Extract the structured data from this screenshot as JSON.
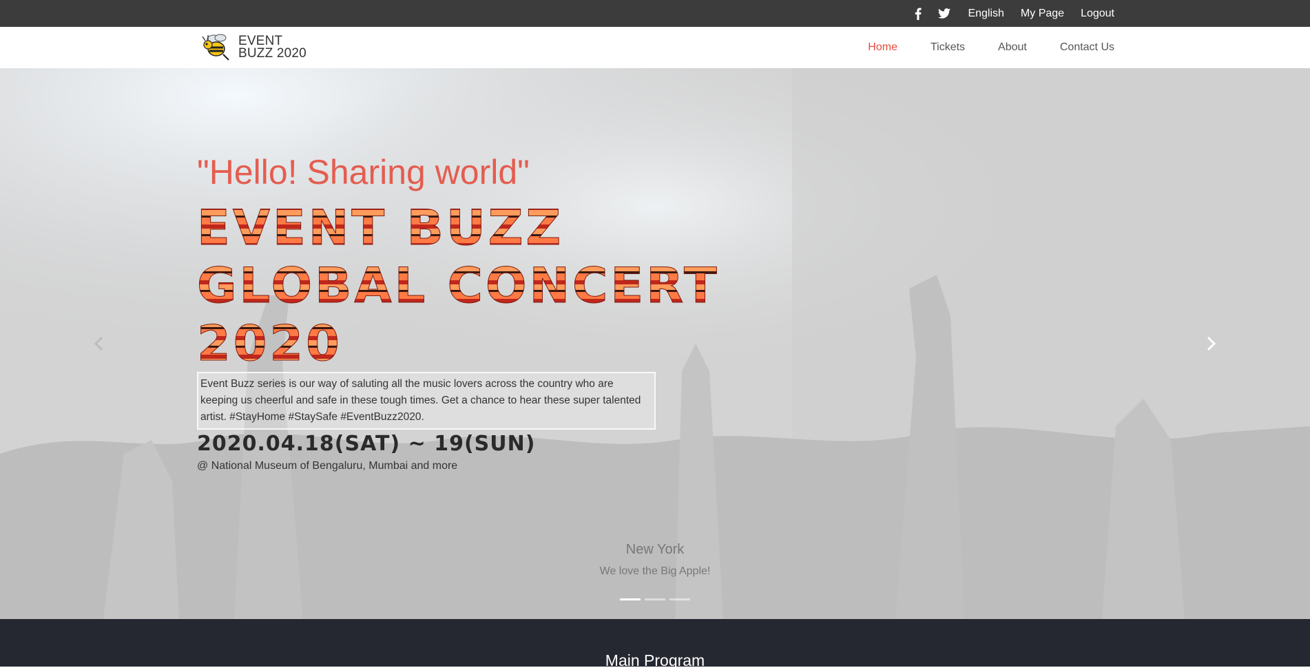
{
  "topbar": {
    "icons": [
      "facebook-icon",
      "twitter-icon"
    ],
    "language": "English",
    "my_page": "My Page",
    "logout": "Logout"
  },
  "logo": {
    "line1": "EVENT",
    "line2": "BUZZ 2020",
    "icon": "bee-icon"
  },
  "nav": {
    "items": [
      {
        "label": "Home",
        "active": true
      },
      {
        "label": "Tickets",
        "active": false
      },
      {
        "label": "About",
        "active": false
      },
      {
        "label": "Contact Us",
        "active": false
      }
    ]
  },
  "hero": {
    "tagline": "\"Hello! Sharing world\"",
    "title_lines": [
      "EVENT BUZZ",
      "GLOBAL CONCERT",
      "2020"
    ],
    "description": "Event Buzz series is our way of saluting all the music lovers across the country who are keeping us cheerful and safe in these tough times. Get a chance to hear these super talented artist. #StayHome #StaySafe #EventBuzz2020.",
    "date": "2020.04.18(SAT) ~ 19(SUN)",
    "venue": "@ National Museum of Bengaluru, Mumbai and more",
    "carousel": {
      "caption_title": "New York",
      "caption_sub": "We love the Big Apple!",
      "slide_count": 3,
      "active_index": 0
    }
  },
  "main_program": {
    "title": "Main Program"
  },
  "colors": {
    "accent": "#e74c3c",
    "topbar_bg": "#3c3c3c",
    "footer_bg": "#252830"
  }
}
